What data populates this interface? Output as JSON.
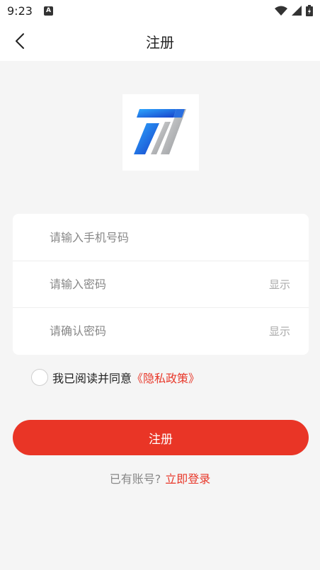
{
  "status_bar": {
    "time": "9:23",
    "notification_letter": "A"
  },
  "nav": {
    "title": "注册"
  },
  "form": {
    "phone_placeholder": "请输入手机号码",
    "password_placeholder": "请输入密码",
    "password_toggle": "显示",
    "confirm_placeholder": "请确认密码",
    "confirm_toggle": "显示"
  },
  "agreement": {
    "text": "我已阅读并同意",
    "link": "《隐私政策》",
    "checked": false
  },
  "register_button": {
    "label": "注册"
  },
  "login": {
    "prompt": "已有账号?",
    "link": "立即登录"
  },
  "colors": {
    "accent": "#e93526",
    "link": "#e8382a",
    "background": "#f5f5f5"
  },
  "icons": {
    "back": "chevron-left-icon",
    "logo": "app-logo-icon",
    "wifi": "wifi-icon",
    "signal": "signal-icon",
    "battery": "battery-icon"
  }
}
